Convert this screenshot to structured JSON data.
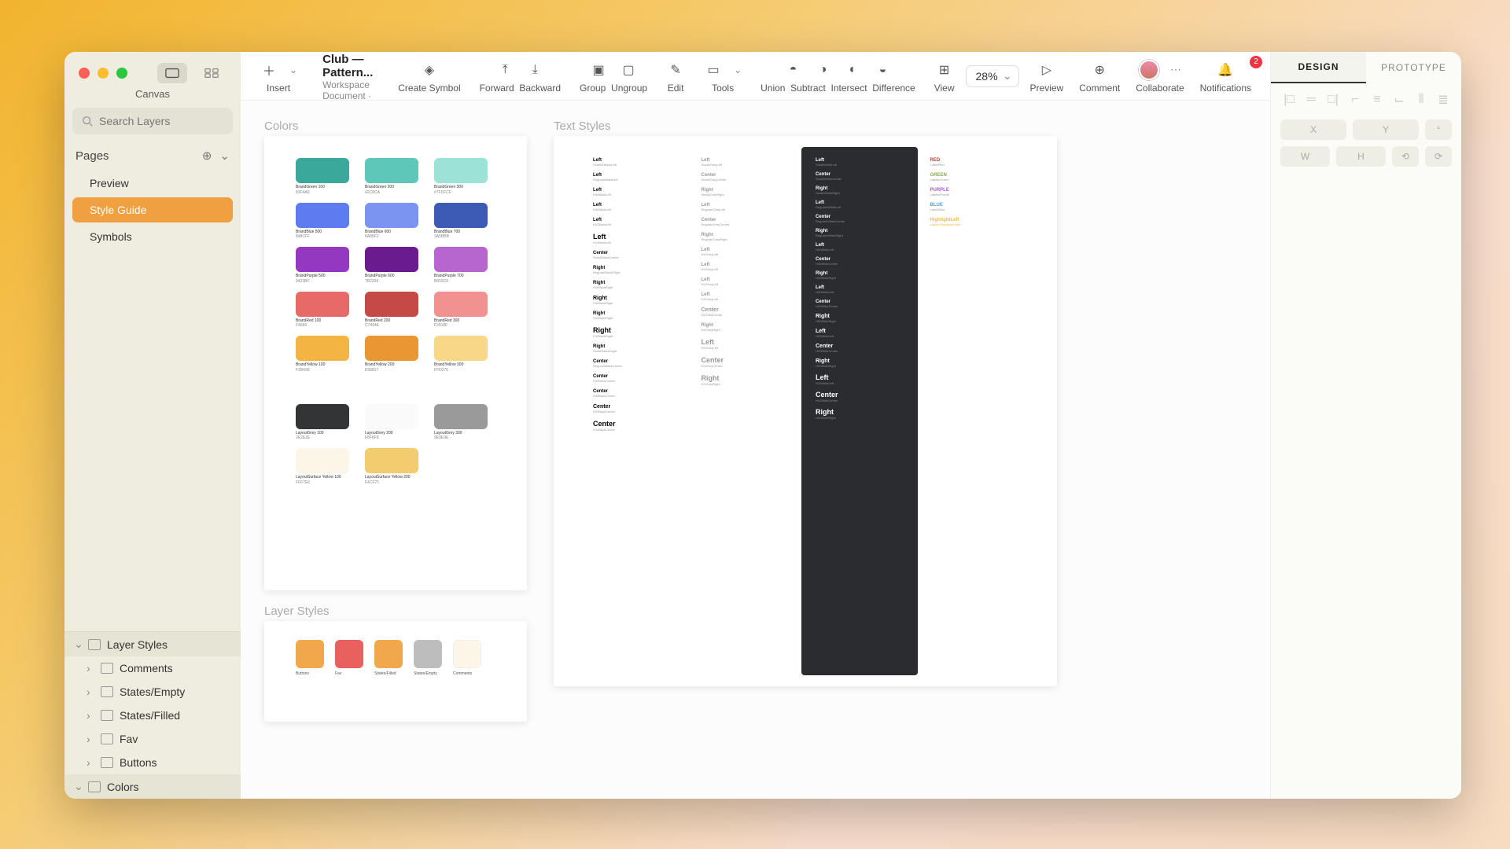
{
  "window": {
    "document_title": "Book Club — Pattern...",
    "document_subtitle": "Workspace Document · sRGB",
    "canvas_label": "Canvas",
    "search_placeholder": "Search Layers"
  },
  "toolbar": {
    "insert": "Insert",
    "create_symbol": "Create Symbol",
    "forward": "Forward",
    "backward": "Backward",
    "group": "Group",
    "ungroup": "Ungroup",
    "edit": "Edit",
    "tools": "Tools",
    "union": "Union",
    "subtract": "Subtract",
    "intersect": "Intersect",
    "difference": "Difference",
    "view": "View",
    "zoom": "28%",
    "preview": "Preview",
    "comment": "Comment",
    "collaborate": "Collaborate",
    "notifications": "Notifications",
    "notif_badge": "2"
  },
  "pages": {
    "header": "Pages",
    "items": [
      "Preview",
      "Style Guide",
      "Symbols"
    ],
    "selected": 1
  },
  "layer_tree": {
    "groups": [
      {
        "name": "Layer Styles",
        "children": [
          "Comments",
          "States/Empty",
          "States/Filled",
          "Fav",
          "Buttons"
        ]
      },
      {
        "name": "Colors",
        "children": []
      }
    ]
  },
  "inspector": {
    "tabs": [
      "DESIGN",
      "PROTOTYPE"
    ],
    "active_tab": 0,
    "dims": {
      "x": "X",
      "y": "Y",
      "w": "W",
      "h": "H"
    }
  },
  "canvas": {
    "colors": {
      "title": "Colors",
      "rows": [
        [
          {
            "name": "BrandGreen 100",
            "hex": "83F4A6",
            "c": "#3aa89a"
          },
          {
            "name": "BrandGreen 200",
            "hex": "42C8CA",
            "c": "#5fc7ba"
          },
          {
            "name": "BrandGreen 300",
            "hex": "#7FDFCF",
            "c": "#9de2d7"
          }
        ],
        [
          {
            "name": "BrandBlue 500",
            "hex": "848CFF",
            "c": "#5e7cf0"
          },
          {
            "name": "BrandBlue 600",
            "hex": "6A85F2",
            "c": "#7b94f2"
          },
          {
            "name": "BrandBlue 700",
            "hex": "3A5BBB",
            "c": "#3b5bb4"
          }
        ],
        [
          {
            "name": "BrandPurple 500",
            "hex": "9423BF",
            "c": "#9438c2"
          },
          {
            "name": "BrandPurple 600",
            "hex": "7B2296",
            "c": "#6a1c8f"
          },
          {
            "name": "BrandPurple 700",
            "hex": "B659C8",
            "c": "#b765cf"
          }
        ],
        [
          {
            "name": "BrandRed 100",
            "hex": "F4666",
            "c": "#e86a68"
          },
          {
            "name": "BrandRed 200",
            "hex": "C7494E",
            "c": "#c54944"
          },
          {
            "name": "BrandRed 300",
            "hex": "F3918F",
            "c": "#f19290"
          }
        ],
        [
          {
            "name": "BrandYellow 100",
            "hex": "F2B42E",
            "c": "#f3b541"
          },
          {
            "name": "BrandYellow 200",
            "hex": "E58817",
            "c": "#e89733"
          },
          {
            "name": "BrandYellow 300",
            "hex": "FFD275",
            "c": "#f9d788"
          }
        ]
      ],
      "rows2": [
        [
          {
            "name": "LayoutGrey 100",
            "hex": "2E2E2E",
            "c": "#333436"
          },
          {
            "name": "LayoutGrey 200",
            "hex": "F8F8F8",
            "c": "#fafafa"
          },
          {
            "name": "LayoutGrey 300",
            "hex": "9E9E9E",
            "c": "#9a9a9a"
          }
        ],
        [
          {
            "name": "LayoutSurface Yellow 100",
            "hex": "FFF7E6",
            "c": "#fdf5e7"
          },
          {
            "name": "LayoutSurface Yellow 200",
            "hex": "F4CF71",
            "c": "#f3cc6f"
          }
        ]
      ]
    },
    "layer_styles_ab": {
      "title": "Layer Styles",
      "items": [
        {
          "name": "Buttons",
          "c": "#f0a84a"
        },
        {
          "name": "Fav",
          "c": "#e8615e"
        },
        {
          "name": "States/Filled",
          "c": "#f0a84a"
        },
        {
          "name": "States/Empty",
          "c": "#bdbdbd"
        },
        {
          "name": "Comments",
          "c": "#fdf6e8"
        }
      ]
    },
    "text_styles": {
      "title": "Text Styles",
      "col1": [
        {
          "l": "Left",
          "s": "SmallerBlackLeft"
        },
        {
          "l": "Left",
          "s": "Regular/BlackLeft"
        },
        {
          "l": "Left",
          "s": "H4/BlackLeft"
        },
        {
          "l": "Left",
          "s": "H3/BlackLeft"
        },
        {
          "l": "Left",
          "s": "H2/BlackLeft"
        },
        {
          "l": "Left",
          "s": "H1/BlackLeft",
          "big": true
        },
        {
          "l": "Center",
          "s": "Small/BlackCenter"
        },
        {
          "l": "Right",
          "s": "Regular/BlackRight"
        },
        {
          "l": "Right",
          "s": "H4/BlackRight"
        },
        {
          "l": "Right",
          "s": "H3/BlackRight",
          "mid": true
        },
        {
          "l": "Right",
          "s": "H2/BlackRight"
        },
        {
          "l": "Right",
          "s": "H1/BlackRight",
          "big": true
        },
        {
          "l": "Right",
          "s": "Small/BlackRight"
        },
        {
          "l": "Center",
          "s": "Regular/BlackCenter"
        },
        {
          "l": "Center",
          "s": "H4/BlackCenter"
        },
        {
          "l": "Center",
          "s": "H3/BlackCenter"
        },
        {
          "l": "Center",
          "s": "H2/BlackCenter",
          "mid": true
        },
        {
          "l": "Center",
          "s": "H1/BlackCenter",
          "big": true
        }
      ],
      "col2": [
        {
          "l": "Left",
          "s": "Small/GreyLeft"
        },
        {
          "l": "Center",
          "s": "Small/GreyCenter"
        },
        {
          "l": "Right",
          "s": "Small/GreyRight"
        },
        {
          "l": "Left",
          "s": "Regular/GreyLeft"
        },
        {
          "l": "Center",
          "s": "Regular/GreyCenter"
        },
        {
          "l": "Right",
          "s": "Regular/GreyRight"
        },
        {
          "l": "Left",
          "s": "H4/GreyLeft"
        },
        {
          "l": "Left",
          "s": "H3/GreyLeft"
        },
        {
          "l": "Left",
          "s": "H2/GreyLeft"
        },
        {
          "l": "Left",
          "s": "H1/GreyLeft"
        },
        {
          "l": "Center",
          "s": "H4/GreyCenter",
          "mid": true
        },
        {
          "l": "Right",
          "s": "H4/GreyRight"
        },
        {
          "l": "Left",
          "s": "H3/GreyLeft",
          "big": true
        },
        {
          "l": "Center",
          "s": "H3/GreyCenter",
          "big": true
        },
        {
          "l": "Right",
          "s": "H3/GreyRight",
          "big": true
        }
      ],
      "col3": [
        {
          "l": "Left",
          "s": "SmallWhiteLeft"
        },
        {
          "l": "Center",
          "s": "Small/WhiteCenter"
        },
        {
          "l": "Right",
          "s": "Small/WhiteRight"
        },
        {
          "l": "Left",
          "s": "Regular/WhiteLeft"
        },
        {
          "l": "Center",
          "s": "Regular/WhiteCenter"
        },
        {
          "l": "Right",
          "s": "Regular/WhiteRight"
        },
        {
          "l": "Left",
          "s": "H4/WhiteLeft"
        },
        {
          "l": "Center",
          "s": "H4/WhiteCenter"
        },
        {
          "l": "Right",
          "s": "H4/WhiteRight"
        },
        {
          "l": "Left",
          "s": "H3/WhiteLeft"
        },
        {
          "l": "Center",
          "s": "H3/WhiteCenter"
        },
        {
          "l": "Right",
          "s": "H3/WhiteRight",
          "mid": true
        },
        {
          "l": "Left",
          "s": "H2/WhiteLeft",
          "mid": true
        },
        {
          "l": "Center",
          "s": "H2/WhiteCenter",
          "mid": true
        },
        {
          "l": "Right",
          "s": "H2/WhiteRight",
          "mid": true
        },
        {
          "l": "Left",
          "s": "H1/WhiteLeft",
          "big": true
        },
        {
          "l": "Center",
          "s": "H1/WhiteCenter",
          "big": true
        },
        {
          "l": "Right",
          "s": "H1/WhiteRight",
          "big": true
        }
      ],
      "col4": [
        {
          "l": "RED",
          "s": "Label/Red"
        },
        {
          "l": "GREEN",
          "s": "Labels/Green"
        },
        {
          "l": "PURPLE",
          "s": "Labels/Purple"
        },
        {
          "l": "BLUE",
          "s": "Label/Blue"
        },
        {
          "l": "HighlightLeft",
          "s": "Labels/HighlightLetter"
        }
      ]
    }
  }
}
